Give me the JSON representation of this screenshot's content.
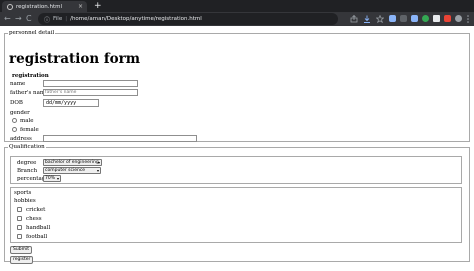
{
  "browser": {
    "tab_title": "registration.html",
    "tab_close": "×",
    "new_tab": "+",
    "back": "←",
    "forward": "→",
    "reload": "C",
    "url_info": "ⓘ",
    "url_scheme": "File",
    "url_separator": "|",
    "url": "/home/aman/Desktop/anytime/registration.html"
  },
  "personnel": {
    "legend": "personnel detail",
    "title": "registration form",
    "section_heading": "registration",
    "name_label": "name",
    "father_label": "father's name",
    "father_placeholder": "father's name",
    "dob_label": "DOB",
    "dob_value": "dd/mm/yyyy",
    "gender_label": "gender",
    "gender_options": [
      "male",
      "female"
    ],
    "address_label": "address"
  },
  "qualification": {
    "legend": "Qualification",
    "degree_label": "degree",
    "degree_value": "bachelor of engineering",
    "branch_label": "Branch",
    "branch_value": "computer science",
    "percentage_label": "percentage",
    "percentage_value": "70%",
    "sports_label": "sports",
    "hobbies_label": "hobbies",
    "hobbies": [
      "cricket",
      "chess",
      "handball",
      "football"
    ],
    "submit_label": "Submit",
    "register_label": "register"
  },
  "colors": {
    "browser_dark": "#202124",
    "browser_toolbar": "#35363a",
    "ext_blue": "#8ab4f8",
    "ext_green": "#34a853",
    "ext_red": "#ea4335"
  }
}
